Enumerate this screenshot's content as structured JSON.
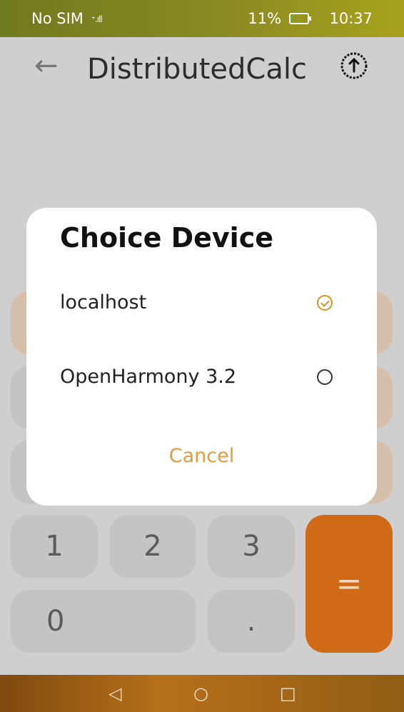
{
  "status_bar": {
    "carrier": "No SIM",
    "signal_icon": "signal-icon",
    "battery": "11%",
    "battery_level": 0.11,
    "time": "10:37"
  },
  "app_bar": {
    "back_icon": "arrow-left-icon",
    "title": "DistributedCalc",
    "share_icon": "continue-device-icon"
  },
  "keypad": {
    "one": "1",
    "two": "2",
    "three": "3",
    "zero": "0",
    "dot": ".",
    "equals": "="
  },
  "dialog": {
    "title": "Choice Device",
    "options": [
      {
        "label": "localhost",
        "selected": true
      },
      {
        "label": "OpenHarmony 3.2",
        "selected": false
      }
    ],
    "cancel": "Cancel"
  },
  "nav_bar": {
    "back": "◁",
    "home": "○",
    "recents": "□"
  },
  "colors": {
    "accent": "#d99324",
    "equals_bg": "#d06a17"
  }
}
